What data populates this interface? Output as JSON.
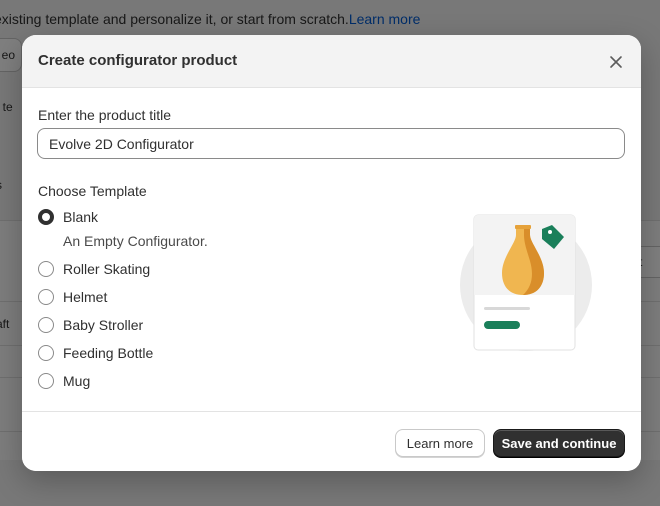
{
  "background": {
    "intro_text": "existing template and personalize it, or start from scratch.",
    "intro_link": "Learn more",
    "button_fragment": "eo",
    "fragment_1": "t te",
    "fragment_2": "s",
    "fragment_3": "aft",
    "pill_fragment": "t"
  },
  "modal": {
    "title": "Create configurator product",
    "close_icon": "close-icon",
    "title_field": {
      "label": "Enter the product title",
      "value": "Evolve 2D Configurator"
    },
    "template": {
      "label": "Choose Template",
      "selected": "Blank",
      "options": [
        {
          "label": "Blank",
          "description": "An Empty Configurator."
        },
        {
          "label": "Roller Skating"
        },
        {
          "label": "Helmet"
        },
        {
          "label": "Baby Stroller"
        },
        {
          "label": "Feeding Bottle"
        },
        {
          "label": "Mug"
        }
      ]
    },
    "footer": {
      "secondary_label": "Learn more",
      "primary_label": "Save and continue"
    }
  },
  "colors": {
    "accent_green": "#1a7f5a",
    "vase_orange": "#e8a33d",
    "primary_button": "#303030",
    "link_blue": "#005bd3"
  }
}
